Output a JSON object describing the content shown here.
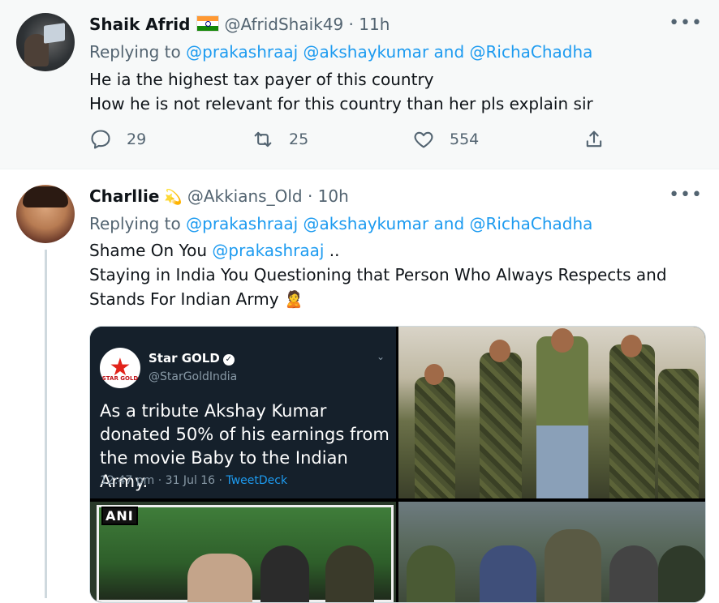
{
  "tweets": [
    {
      "name": "Shaik Afrid",
      "handle": "@AfridShaik49",
      "time": "· 11h",
      "replying_prefix": "Replying to",
      "replying_to_1": "@prakashraaj",
      "replying_to_2": "@akshaykumar",
      "replying_and": "and",
      "replying_to_3": "@RichaChadha",
      "text_line_1": "He ia the highest tax payer of this country",
      "text_line_2": "How he is not relevant for this country than her pls explain sir",
      "replies": "29",
      "retweets": "25",
      "likes": "554",
      "more": "•••"
    },
    {
      "name": "Charllie",
      "handle": "@Akkians_Old",
      "time": "· 10h",
      "replying_prefix": "Replying to",
      "replying_to_1": "@prakashraaj",
      "replying_to_2": "@akshaykumar",
      "replying_and": "and",
      "replying_to_3": "@RichaChadha",
      "text_line_1_prefix": "Shame On You",
      "text_line_1_mention": "@prakashraaj",
      "text_line_1_suffix": "..",
      "text_line_2": "Staying in India You Questioning that Person Who Always Respects and",
      "text_line_3": "Stands For Indian Army",
      "more": "•••",
      "media": {
        "embedded_tweet": {
          "logo_label": "STAR GOLD",
          "name": "Star GOLD",
          "handle": "@StarGoldIndia",
          "text": "As a tribute Akshay Kumar donated 50% of his earnings from the movie Baby to the Indian Army.",
          "timestamp": "12:47 pm · 31 Jul 16 ·",
          "source": "TweetDeck"
        },
        "photo3_watermark": "ANI"
      }
    }
  ],
  "icons": [
    "reply-icon",
    "retweet-icon",
    "like-icon",
    "share-icon",
    "more-icon",
    "verified-icon",
    "india-flag-icon",
    "dizzy-emoji-icon",
    "person-emoji-icon"
  ],
  "colors": {
    "link": "#1d9bf0",
    "secondary_text": "#536471",
    "primary_text": "#0f1419",
    "highlight_bg": "#f7f9f9"
  }
}
